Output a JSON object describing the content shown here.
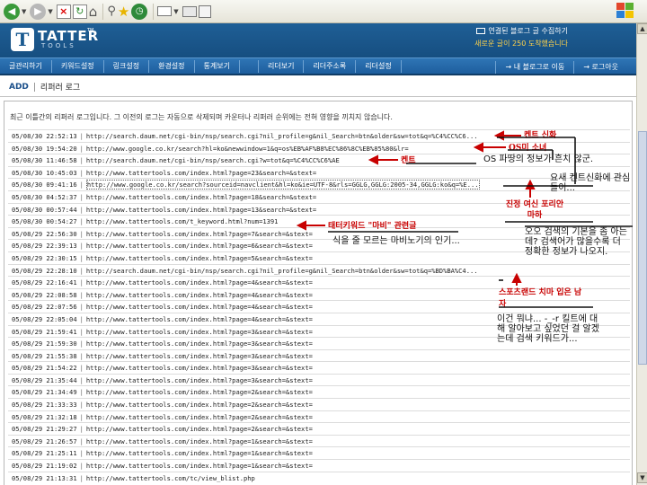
{
  "colors": {
    "header_bg": "#1a5a90",
    "nav_bg": "#2a6fb0",
    "accent_yellow": "#ffd24a",
    "annotation_red": "#c80000"
  },
  "browser_toolbar": {
    "icons": [
      "back-icon",
      "forward-icon",
      "stop-icon",
      "refresh-icon",
      "home-icon",
      "search-icon",
      "favorites-icon",
      "history-icon",
      "mail-icon",
      "print-icon",
      "edit-icon",
      "windows-logo-icon"
    ]
  },
  "header": {
    "logo_letter": "T",
    "logo_text": "TATTER",
    "logo_sub": "TOOLS",
    "logo_tm": "TM",
    "top_link": "연결된 블로그 글 수집하기",
    "notice": "새로운 글이 250 도착했습니다"
  },
  "nav": {
    "items": [
      "글관리하기",
      "키워드설정",
      "링크설정",
      "환경설정",
      "통계보기",
      "리더보기",
      "리더주소록",
      "리더설정"
    ],
    "right": [
      "→ 내 블로그로 이동",
      "→ 로그아웃"
    ]
  },
  "subheader": {
    "add": "ADD",
    "title": "리퍼러 로그"
  },
  "description": "최근 이틀간의 리퍼러 로그입니다. 그 이전의 로그는 자동으로 삭제되며 카운터나 리퍼러 순위에는 전혀 영향을 끼치지 않습니다.",
  "log_rows": [
    {
      "date": "05/08/30 22:52:13",
      "url": "http://search.daum.net/cgi-bin/nsp/search.cgi?nil_profile=g&nil_Search=btn&older&sw=tot&q=%C4%CC%C6..."
    },
    {
      "date": "05/08/30 19:54:20",
      "url": "http://www.google.co.kr/search?hl=ko&newwindow=1&q=os%EB%AF%B8%EC%86%8C%EB%85%80&lr="
    },
    {
      "date": "05/08/30 11:46:58",
      "url": "http://search.daum.net/cgi-bin/nsp/search.cgi?w=tot&q=%C4%CC%C6%AE"
    },
    {
      "date": "05/08/30 10:45:03",
      "url": "http://www.tattertools.com/index.html?page=23&search=&stext="
    },
    {
      "date": "05/08/30 09:41:16",
      "url": "http://www.google.co.kr/search?sourceid=navclient&hl=ko&ie=UTF-8&rls=GGLG,GGLG:2005-34,GGLG:ko&q=%E..."
    },
    {
      "date": "05/08/30 04:52:37",
      "url": "http://www.tattertools.com/index.html?page=18&search=&stext="
    },
    {
      "date": "05/08/30 00:57:44",
      "url": "http://www.tattertools.com/index.html?page=13&search=&stext="
    },
    {
      "date": "05/08/30 00:54:27",
      "url": "http://www.tattertools.com/t_keyword.html?num=1391"
    },
    {
      "date": "05/08/29 22:56:30",
      "url": "http://www.tattertools.com/index.html?page=7&search=&stext="
    },
    {
      "date": "05/08/29 22:39:13",
      "url": "http://www.tattertools.com/index.html?page=6&search=&stext="
    },
    {
      "date": "05/08/29 22:30:15",
      "url": "http://www.tattertools.com/index.html?page=5&search=&stext="
    },
    {
      "date": "05/08/29 22:28:10",
      "url": "http://search.daum.net/cgi-bin/nsp/search.cgi?nil_profile=g&nil_Search=btn&older&sw=tot&q=%BD%BA%C4..."
    },
    {
      "date": "05/08/29 22:16:41",
      "url": "http://www.tattertools.com/index.html?page=4&search=&stext="
    },
    {
      "date": "05/08/29 22:08:58",
      "url": "http://www.tattertools.com/index.html?page=4&search=&stext="
    },
    {
      "date": "05/08/29 22:07:56",
      "url": "http://www.tattertools.com/index.html?page=4&search=&stext="
    },
    {
      "date": "05/08/29 22:05:04",
      "url": "http://www.tattertools.com/index.html?page=4&search=&stext="
    },
    {
      "date": "05/08/29 21:59:41",
      "url": "http://www.tattertools.com/index.html?page=3&search=&stext="
    },
    {
      "date": "05/08/29 21:59:30",
      "url": "http://www.tattertools.com/index.html?page=3&search=&stext="
    },
    {
      "date": "05/08/29 21:55:38",
      "url": "http://www.tattertools.com/index.html?page=3&search=&stext="
    },
    {
      "date": "05/08/29 21:54:22",
      "url": "http://www.tattertools.com/index.html?page=3&search=&stext="
    },
    {
      "date": "05/08/29 21:35:44",
      "url": "http://www.tattertools.com/index.html?page=3&search=&stext="
    },
    {
      "date": "05/08/29 21:34:49",
      "url": "http://www.tattertools.com/index.html?page=2&search=&stext="
    },
    {
      "date": "05/08/29 21:33:33",
      "url": "http://www.tattertools.com/index.html?page=2&search=&stext="
    },
    {
      "date": "05/08/29 21:32:18",
      "url": "http://www.tattertools.com/index.html?page=2&search=&stext="
    },
    {
      "date": "05/08/29 21:29:27",
      "url": "http://www.tattertools.com/index.html?page=2&search=&stext="
    },
    {
      "date": "05/08/29 21:26:57",
      "url": "http://www.tattertools.com/index.html?page=1&search=&stext="
    },
    {
      "date": "05/08/29 21:25:11",
      "url": "http://www.tattertools.com/index.html?page=1&search=&stext="
    },
    {
      "date": "05/08/29 21:19:02",
      "url": "http://www.tattertools.com/index.html?page=1&search=&stext="
    },
    {
      "date": "05/08/29 21:13:31",
      "url": "http://www.tattertools.com/tc/view_blist.php"
    }
  ],
  "annotations": {
    "red": [
      "켄트 신화",
      "OS미 소녀",
      "켄트",
      "진정 여신 포리안 마하",
      "태터키워드 \"마비\" 관련글",
      "스포츠랜드 치마 입은 남자"
    ],
    "black": [
      "OS 파땅의 정보가 흔치 않군.",
      "요새 켄트신화에 관심들이...",
      "식을 줄 모르는 마비노기의 인기...",
      "오오 검색의 기본을 좀 아는데? 검색어가 많을수록 더 정확한 정보가 나오지.",
      "이건 뭐냐... -_-r 킬트에 대해 알아보고 싶었던 걸 알겠는데 검색 키워드가..."
    ]
  }
}
